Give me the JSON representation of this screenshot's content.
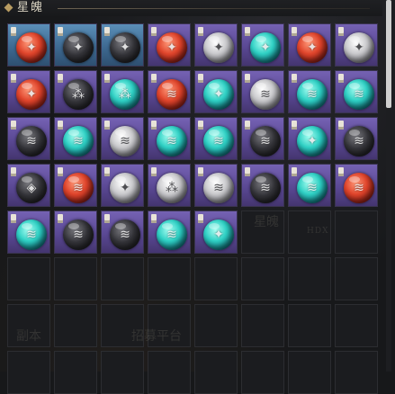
{
  "header": {
    "title": "星魄"
  },
  "background_labels": {
    "label_1": "星魄",
    "label_2": "副本",
    "label_3": "招募平台",
    "label_4": "HDX"
  },
  "inventory": {
    "columns": 8,
    "total_slots": 64,
    "items": [
      {
        "frame": "blue",
        "orb": "red",
        "glyph": "✦"
      },
      {
        "frame": "blue",
        "orb": "dark",
        "glyph": "✦"
      },
      {
        "frame": "blue",
        "orb": "dark",
        "glyph": "✦"
      },
      {
        "frame": "purple",
        "orb": "red",
        "glyph": "✦"
      },
      {
        "frame": "purple",
        "orb": "white",
        "glyph": "✦"
      },
      {
        "frame": "purple",
        "orb": "cyan",
        "glyph": "✦"
      },
      {
        "frame": "purple",
        "orb": "red",
        "glyph": "✦"
      },
      {
        "frame": "purple",
        "orb": "white",
        "glyph": "✦"
      },
      {
        "frame": "purple",
        "orb": "red",
        "glyph": "✦"
      },
      {
        "frame": "purple",
        "orb": "dark",
        "glyph": "⁂"
      },
      {
        "frame": "purple",
        "orb": "cyan",
        "glyph": "⁂"
      },
      {
        "frame": "purple",
        "orb": "red",
        "glyph": "≋"
      },
      {
        "frame": "purple",
        "orb": "cyan",
        "glyph": "✦"
      },
      {
        "frame": "purple",
        "orb": "white",
        "glyph": "≋"
      },
      {
        "frame": "purple",
        "orb": "cyan",
        "glyph": "≋"
      },
      {
        "frame": "purple",
        "orb": "cyan",
        "glyph": "≋"
      },
      {
        "frame": "purple",
        "orb": "dark",
        "glyph": "≋"
      },
      {
        "frame": "purple",
        "orb": "cyan",
        "glyph": "≋"
      },
      {
        "frame": "purple",
        "orb": "white",
        "glyph": "≋"
      },
      {
        "frame": "purple",
        "orb": "cyan",
        "glyph": "≋"
      },
      {
        "frame": "purple",
        "orb": "cyan",
        "glyph": "≋"
      },
      {
        "frame": "purple",
        "orb": "dark",
        "glyph": "≋"
      },
      {
        "frame": "purple",
        "orb": "cyan",
        "glyph": "✦"
      },
      {
        "frame": "purple",
        "orb": "dark",
        "glyph": "≋"
      },
      {
        "frame": "purple",
        "orb": "dark",
        "glyph": "◈"
      },
      {
        "frame": "purple",
        "orb": "red",
        "glyph": "≋"
      },
      {
        "frame": "purple",
        "orb": "white",
        "glyph": "✦"
      },
      {
        "frame": "purple",
        "orb": "white",
        "glyph": "⁂"
      },
      {
        "frame": "purple",
        "orb": "white",
        "glyph": "≋"
      },
      {
        "frame": "purple",
        "orb": "dark",
        "glyph": "≋"
      },
      {
        "frame": "purple",
        "orb": "cyan",
        "glyph": "≋"
      },
      {
        "frame": "purple",
        "orb": "red",
        "glyph": "≋"
      },
      {
        "frame": "purple",
        "orb": "cyan",
        "glyph": "≋"
      },
      {
        "frame": "purple",
        "orb": "dark",
        "glyph": "≋"
      },
      {
        "frame": "purple",
        "orb": "dark",
        "glyph": "≋"
      },
      {
        "frame": "purple",
        "orb": "cyan",
        "glyph": "≋"
      },
      {
        "frame": "purple",
        "orb": "cyan",
        "glyph": "✦"
      }
    ]
  }
}
